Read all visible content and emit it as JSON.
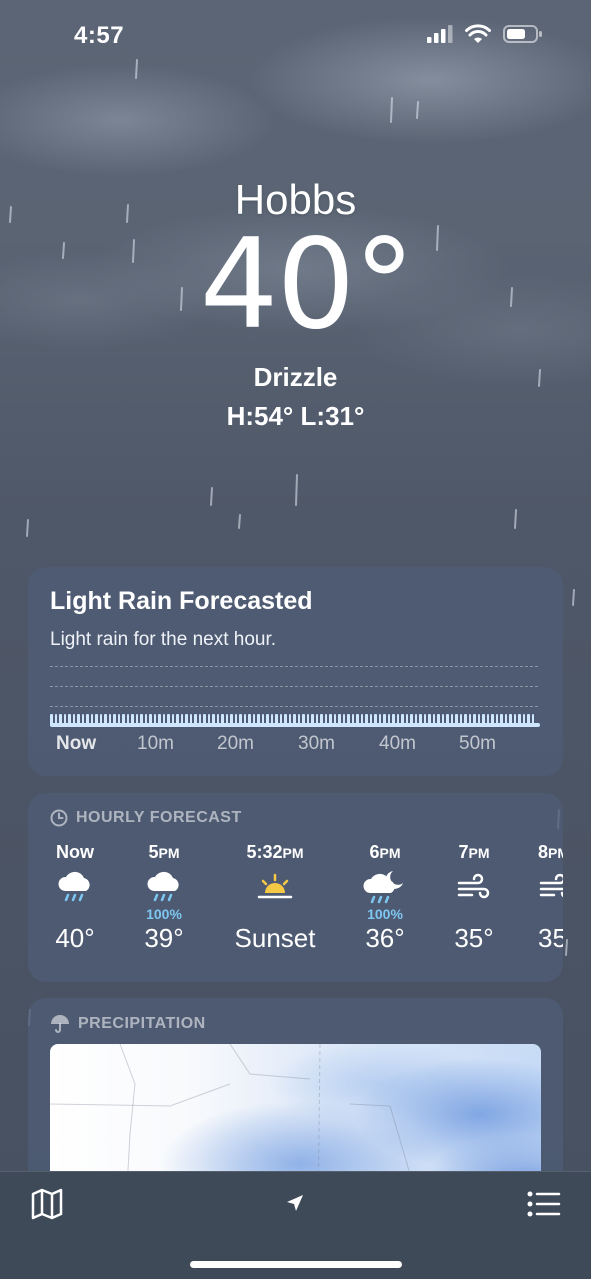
{
  "status_bar": {
    "time": "4:57"
  },
  "location": {
    "city": "Hobbs",
    "temperature": "40°",
    "condition": "Drizzle",
    "high_low": "H:54°  L:31°"
  },
  "precip_card": {
    "title": "Light Rain Forecasted",
    "subtitle": "Light rain for the next hour.",
    "time_labels": [
      "Now",
      "10m",
      "20m",
      "30m",
      "40m",
      "50m"
    ]
  },
  "hourly": {
    "header": "HOURLY FORECAST",
    "items": [
      {
        "time": "Now",
        "suffix": "",
        "icon": "rain-cloud-icon",
        "pct": "",
        "temp": "40°"
      },
      {
        "time": "5",
        "suffix": "PM",
        "icon": "rain-cloud-icon",
        "pct": "100%",
        "temp": "39°"
      },
      {
        "time": "5:32",
        "suffix": "PM",
        "icon": "sunset-icon",
        "pct": "",
        "temp": "Sunset"
      },
      {
        "time": "6",
        "suffix": "PM",
        "icon": "moon-rain-cloud-icon",
        "pct": "100%",
        "temp": "36°"
      },
      {
        "time": "7",
        "suffix": "PM",
        "icon": "wind-icon",
        "pct": "",
        "temp": "35°"
      },
      {
        "time": "8",
        "suffix": "PM",
        "icon": "wind-icon",
        "pct": "",
        "temp": "35°"
      }
    ]
  },
  "precipitation": {
    "header": "PRECIPITATION"
  },
  "tab_bar": {
    "items": [
      "map-icon",
      "location-arrow-icon",
      "list-icon"
    ]
  },
  "colors": {
    "card": "#4e5c76",
    "precip_accent": "#7ec7f0",
    "tab_bar": "#3f4a59"
  }
}
